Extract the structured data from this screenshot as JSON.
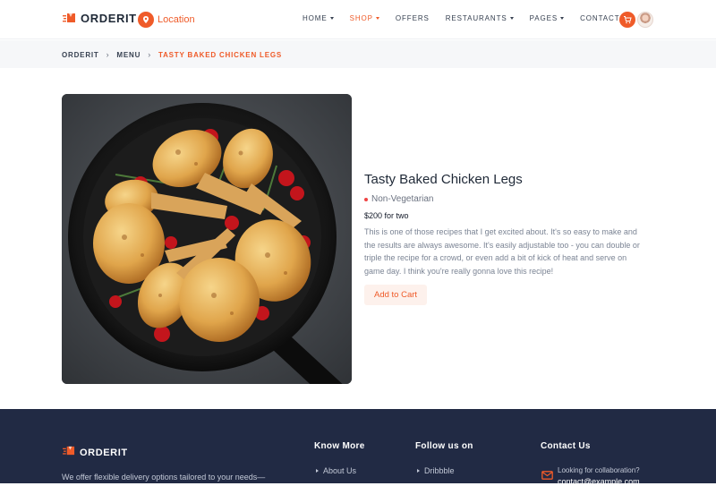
{
  "header": {
    "brand": "ORDERIT",
    "location_label": "Location",
    "nav": [
      {
        "label": "HOME",
        "has_caret": true,
        "active": false
      },
      {
        "label": "SHOP",
        "has_caret": true,
        "active": true
      },
      {
        "label": "OFFERS",
        "has_caret": false,
        "active": false
      },
      {
        "label": "RESTAURANTS",
        "has_caret": true,
        "active": false
      },
      {
        "label": "PAGES",
        "has_caret": true,
        "active": false
      },
      {
        "label": "CONTACT US",
        "has_caret": false,
        "active": false
      }
    ],
    "cart_icon": "shopping-cart-icon",
    "avatar_icon": "user-avatar"
  },
  "breadcrumb": {
    "items": [
      "ORDERIT",
      "MENU"
    ],
    "current": "TASTY BAKED CHICKEN LEGS",
    "separator": "›"
  },
  "product": {
    "image_icon": "baked-chicken-legs-photo",
    "title": "Tasty Baked Chicken Legs",
    "diet": "Non-Vegetarian",
    "price": "$200 for two",
    "description": "This is one of those recipes that I get excited about. It's so easy to make and the results are always awesome. It's easily adjustable too - you can double or triple the recipe for a crowd, or even add a bit of kick of heat and serve on game day. I think you're really gonna love this recipe!",
    "add_to_cart": "Add to Cart"
  },
  "footer": {
    "brand": "ORDERIT",
    "tagline": "We offer flexible delivery options tailored to your needs—",
    "know_more": {
      "heading": "Know More",
      "first_link": "About Us"
    },
    "follow": {
      "heading": "Follow us on",
      "first_link": "Dribbble"
    },
    "contact": {
      "heading": "Contact Us",
      "collab": "Looking for collaboration?",
      "email": "contact@example.com"
    }
  },
  "colors": {
    "accent": "#ef5b29",
    "footer_bg": "#212a44",
    "breadcrumb_bg": "#f6f7f9",
    "veg_dot": "#ef4444"
  }
}
